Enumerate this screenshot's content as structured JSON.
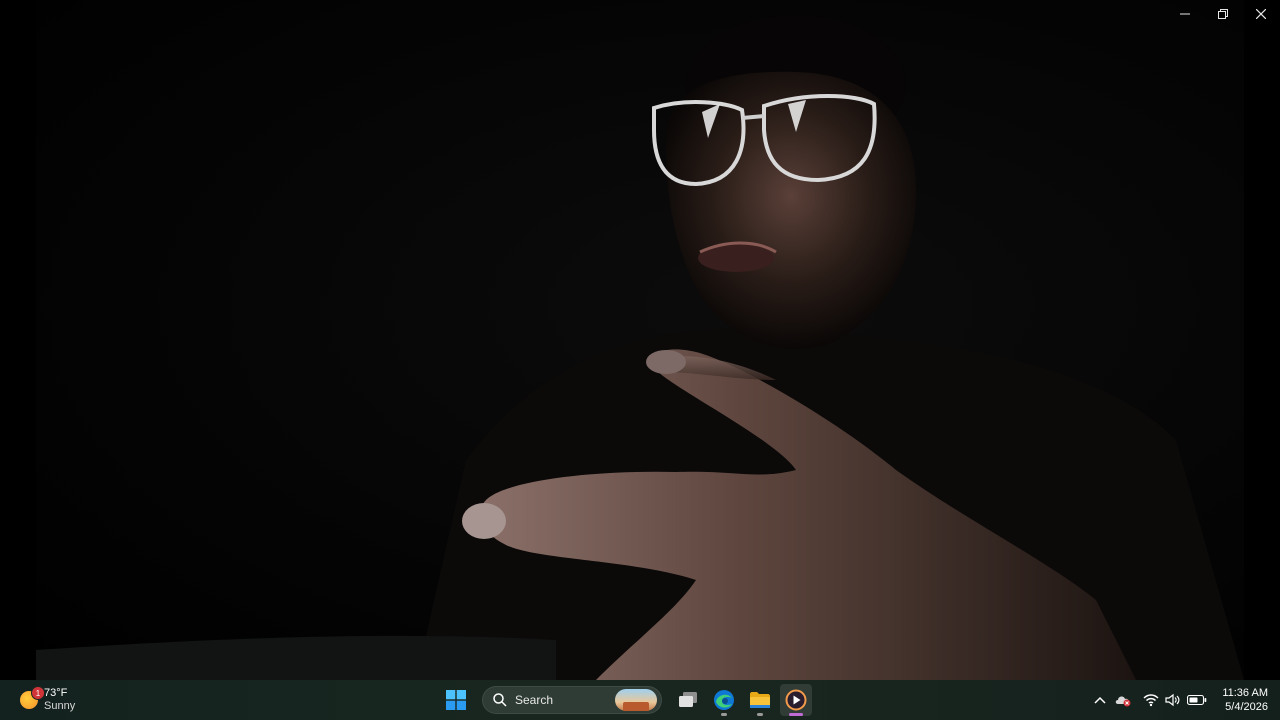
{
  "window": {
    "minimize_icon": "minimize-icon",
    "restore_icon": "restore-icon",
    "close_icon": "close-icon"
  },
  "taskbar": {
    "weather": {
      "temperature": "73°F",
      "condition": "Sunny",
      "badge_count": "1",
      "icon": "sun-icon"
    },
    "search": {
      "placeholder": "Search",
      "icon": "search-icon"
    },
    "pinned": [
      {
        "name": "Start",
        "icon": "windows-logo-icon"
      },
      {
        "name": "Task View",
        "icon": "task-view-icon"
      },
      {
        "name": "Microsoft Edge",
        "icon": "edge-icon"
      },
      {
        "name": "File Explorer",
        "icon": "folder-icon"
      },
      {
        "name": "Media Player",
        "icon": "media-player-icon",
        "active": true
      }
    ],
    "tray": {
      "icons": [
        "chevron-up-icon",
        "onedrive-icon",
        "wifi-icon",
        "volume-icon",
        "battery-icon"
      ],
      "time": "11:36 AM",
      "date": "5/4/2026"
    }
  },
  "colors": {
    "taskbar_bg": "#17261f",
    "active_indicator": "#c26bd6",
    "edge_blue": "#0f78d4",
    "folder_yellow": "#f8c23b"
  }
}
